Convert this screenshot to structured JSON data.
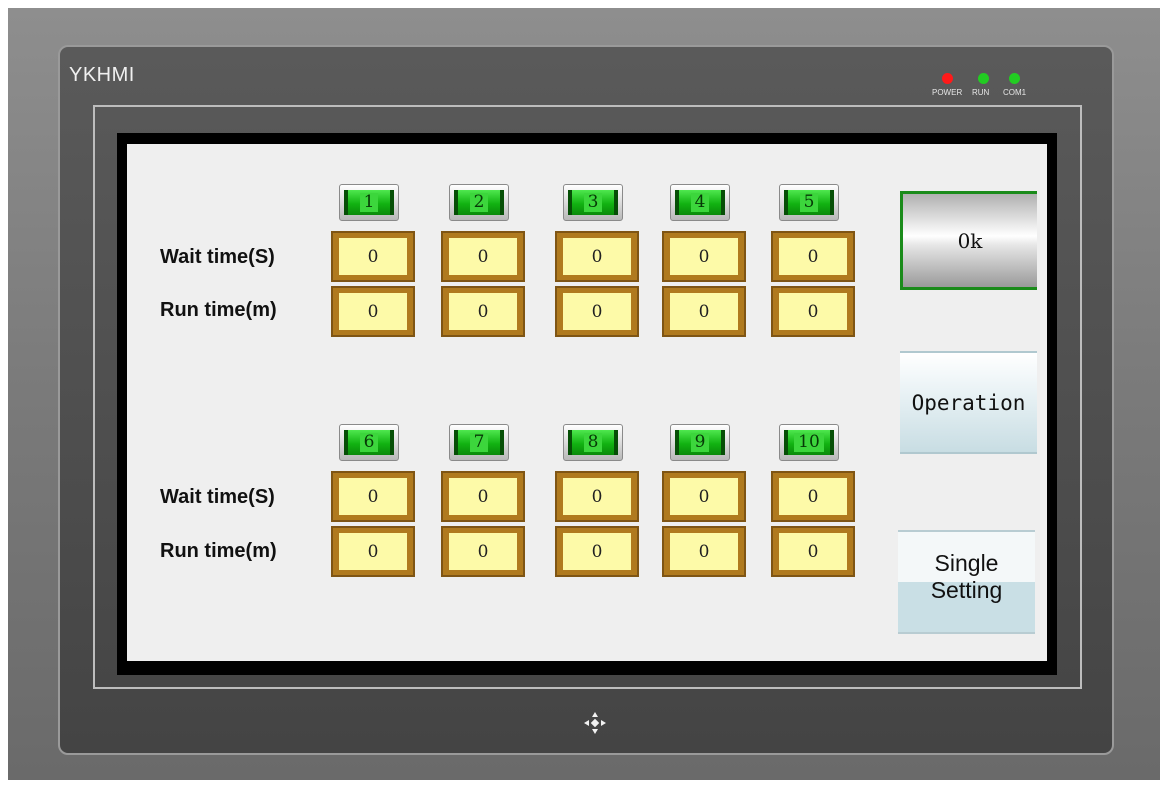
{
  "device": {
    "brand": "YKHMI",
    "leds": [
      {
        "label": "POWER",
        "color": "#ff1a1a"
      },
      {
        "label": "RUN",
        "color": "#22cc22"
      },
      {
        "label": "COM1",
        "color": "#22cc22"
      }
    ]
  },
  "labels": {
    "wait_time": "Wait time(S)",
    "run_time": "Run time(m)"
  },
  "groups": [
    {
      "channels": [
        {
          "num": "1",
          "wait": "0",
          "run": "0"
        },
        {
          "num": "2",
          "wait": "0",
          "run": "0"
        },
        {
          "num": "3",
          "wait": "0",
          "run": "0"
        },
        {
          "num": "4",
          "wait": "0",
          "run": "0"
        },
        {
          "num": "5",
          "wait": "0",
          "run": "0"
        }
      ]
    },
    {
      "channels": [
        {
          "num": "6",
          "wait": "0",
          "run": "0"
        },
        {
          "num": "7",
          "wait": "0",
          "run": "0"
        },
        {
          "num": "8",
          "wait": "0",
          "run": "0"
        },
        {
          "num": "9",
          "wait": "0",
          "run": "0"
        },
        {
          "num": "10",
          "wait": "0",
          "run": "0"
        }
      ]
    }
  ],
  "buttons": {
    "ok": "0k",
    "operation": "Operation",
    "single_line1": "Single",
    "single_line2": "Setting"
  },
  "icons": {
    "home": "four-arrows-diamond-icon"
  }
}
